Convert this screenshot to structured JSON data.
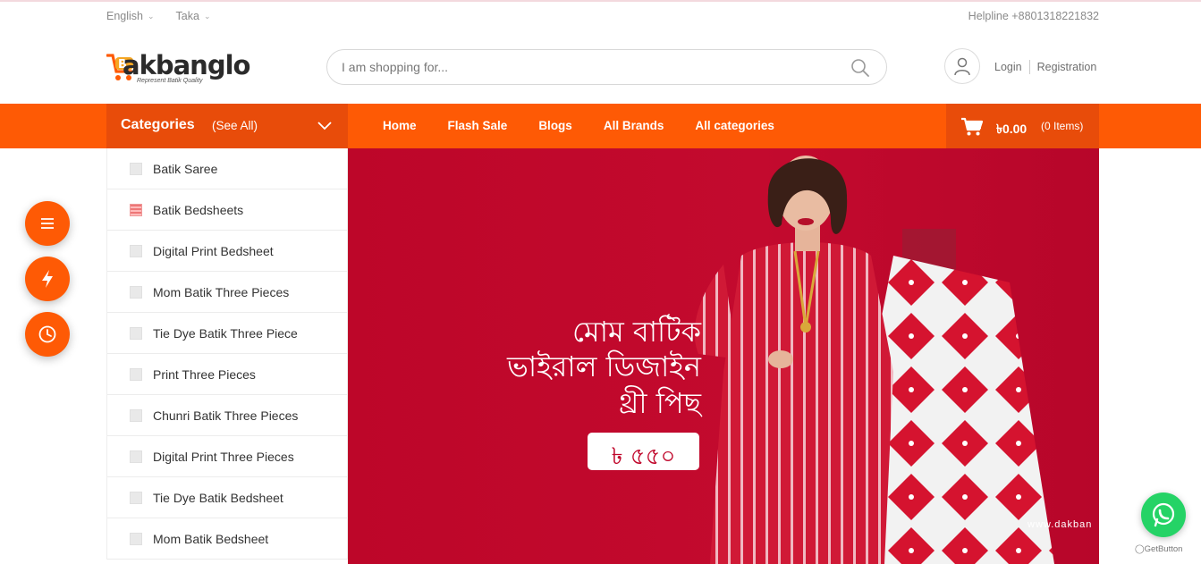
{
  "topbar": {
    "language": "English",
    "currency": "Taka",
    "helpline": "Helpline +8801318221832"
  },
  "header": {
    "logo_text": "akbanglo",
    "logo_tagline": "Represent Batik Quality",
    "search_placeholder": "I am shopping for...",
    "login": "Login",
    "registration": "Registration"
  },
  "nav": {
    "categories_label": "Categories",
    "see_all": "(See All)",
    "links": [
      "Home",
      "Flash Sale",
      "Blogs",
      "All Brands",
      "All categories"
    ],
    "cart_total": "৳0.00",
    "cart_items": "(0 Items)"
  },
  "categories": [
    "Batik Saree",
    "Batik Bedsheets",
    "Digital Print Bedsheet",
    "Mom Batik Three Pieces",
    "Tie Dye Batik Three Piece",
    "Print Three Pieces",
    "Chunri Batik Three Pieces",
    "Digital Print Three Pieces",
    "Tie Dye Batik Bedsheet",
    "Mom Batik Bedsheet"
  ],
  "banner": {
    "line1": "মোম বাটিক",
    "line2": "ভাইরাল ডিজাইন",
    "line3": "থ্রী পিছ",
    "price": "৳ ৫৫০",
    "watermark": "www.dakban"
  },
  "floating": {
    "icons": [
      "menu-icon",
      "flash-icon",
      "clock-icon"
    ],
    "whatsapp_label": "GetButton"
  },
  "colors": {
    "primary": "#fe5a05",
    "primary_dark": "#e84c0a",
    "banner_red": "#c0072b",
    "whatsapp": "#25d366"
  }
}
